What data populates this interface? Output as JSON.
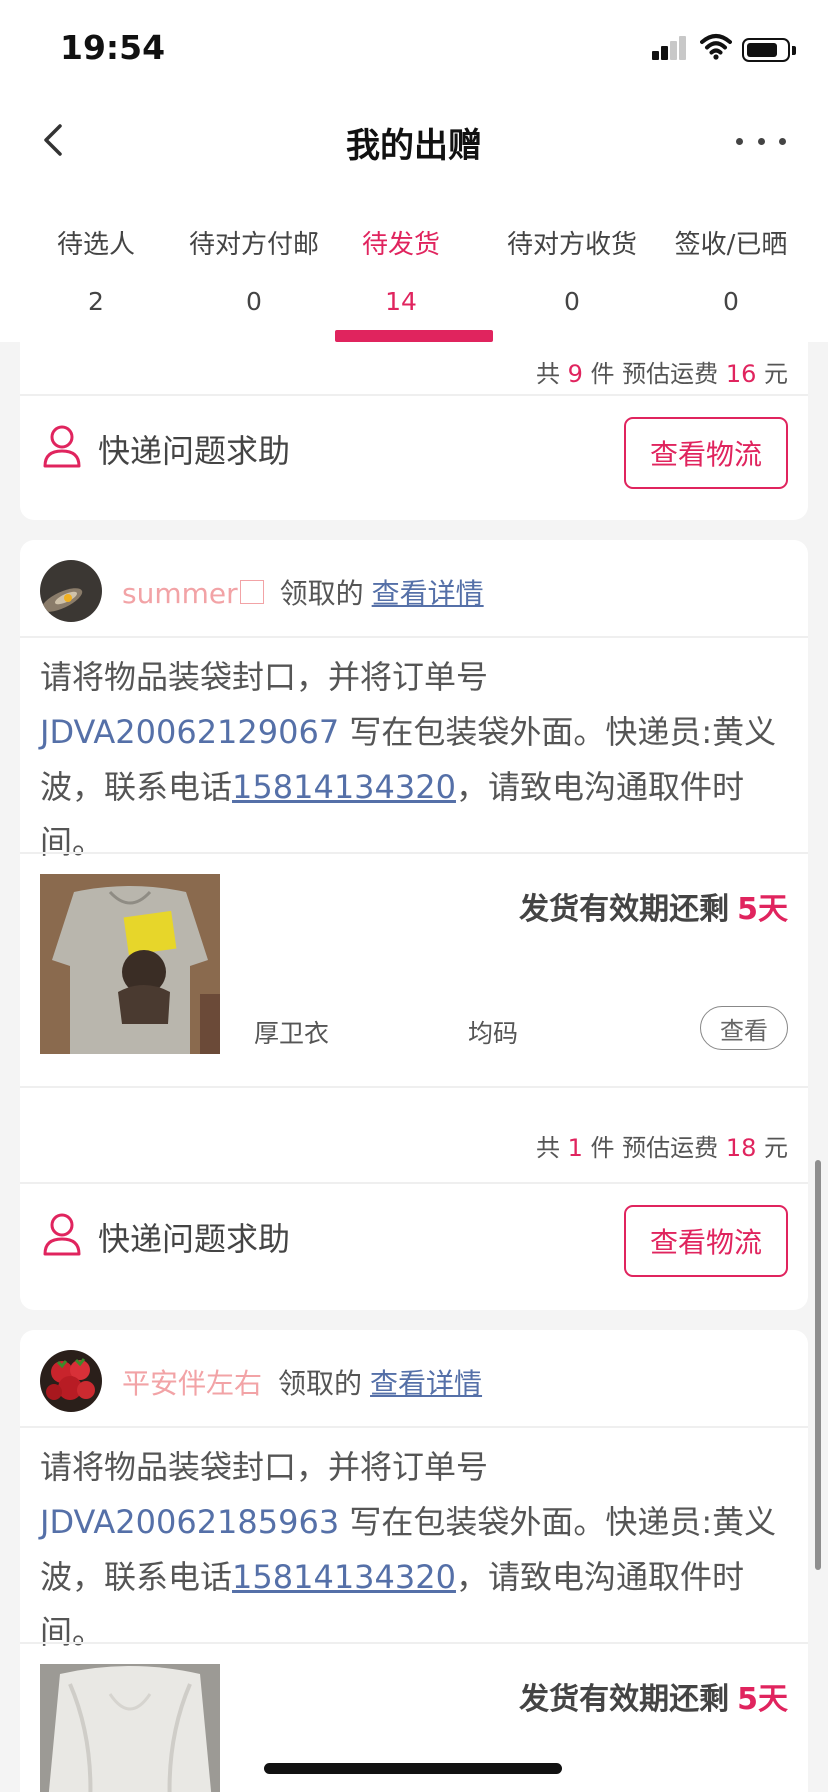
{
  "status_bar": {
    "time": "19:54",
    "icons": [
      "signal-icon",
      "wifi-icon",
      "battery-icon"
    ]
  },
  "navbar": {
    "title": "我的出赠",
    "back_icon": "chevron-left-icon",
    "more_icon": "more-dots-icon"
  },
  "tabs": [
    {
      "label": "待选人",
      "count": "2",
      "active": false
    },
    {
      "label": "待对方付邮",
      "count": "0",
      "active": false
    },
    {
      "label": "待发货",
      "count": "14",
      "active": true
    },
    {
      "label": "待对方收货",
      "count": "0",
      "active": false
    },
    {
      "label": "签收/已晒",
      "count": "0",
      "active": false
    }
  ],
  "common": {
    "help_label": "快递问题求助",
    "logistics_label": "查看物流",
    "received_label": "领取的",
    "detail_label": "查看详情",
    "view_label": "查看",
    "deadline_label": "发货有效期还剩",
    "summary_total": "共",
    "summary_unit": "件",
    "summary_fee": "预估运费",
    "summary_currency": "元"
  },
  "orders": [
    {
      "summary_count": "9",
      "summary_fee": "16"
    },
    {
      "nickname": "summer",
      "instruction_prefix": "请将物品装袋封口，并将订单号 ",
      "order_code": "JDVA20062129067",
      "instruction_mid": " 写在包装袋外面。快递员:黄义波，联系电话",
      "phone": "15814134320",
      "instruction_suffix": "，请致电沟通取件时间。",
      "deadline_days": "5天",
      "item_name": "厚卫衣",
      "item_size": "均码",
      "summary_count": "1",
      "summary_fee": "18"
    },
    {
      "nickname": "平安伴左右",
      "instruction_prefix": "请将物品装袋封口，并将订单号 ",
      "order_code": "JDVA20062185963",
      "instruction_mid": " 写在包装袋外面。快递员:黄义波，联系电话",
      "phone": "15814134320",
      "instruction_suffix": "，请致电沟通取件时间。",
      "deadline_days": "5天"
    }
  ],
  "colors": {
    "accent": "#e0245e",
    "link": "#5570a8",
    "nickname": "#f2a3a6",
    "background": "#f4f4f4"
  }
}
